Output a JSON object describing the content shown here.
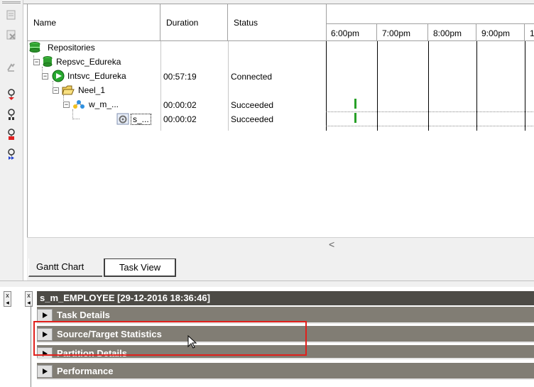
{
  "grid": {
    "headers": {
      "name": "Name",
      "duration": "Duration",
      "status": "Status"
    },
    "time_columns": [
      "6:00pm",
      "7:00pm",
      "8:00pm",
      "9:00pm",
      "1"
    ],
    "rows": [
      {
        "name": "Repositories",
        "duration": "",
        "status": ""
      },
      {
        "name": "Repsvc_Edureka",
        "duration": "",
        "status": ""
      },
      {
        "name": "Intsvc_Edureka",
        "duration": "00:57:19",
        "status": "Connected"
      },
      {
        "name": "Neel_1",
        "duration": "",
        "status": ""
      },
      {
        "name": "w_m_...",
        "duration": "00:00:02",
        "status": "Succeeded"
      },
      {
        "name": "s_...",
        "duration": "00:00:02",
        "status": "Succeeded"
      }
    ],
    "tree_glyphs": {
      "minus": "−"
    }
  },
  "scroll": {
    "left_arrow": "<"
  },
  "tabs": [
    {
      "label": "Gantt Chart",
      "active": false
    },
    {
      "label": "Task View",
      "active": true
    }
  ],
  "details": {
    "title": "s_m_EMPLOYEE [29-12-2016 18:36:46]",
    "sections": [
      {
        "label": "Task Details"
      },
      {
        "label": "Source/Target Statistics"
      },
      {
        "label": "Partition Details"
      },
      {
        "label": "Performance"
      }
    ],
    "mini_ctrl_glyphs": [
      "x",
      "◂"
    ]
  },
  "colors": {
    "title_bar": "#4d4b46",
    "section_bar": "#817d74",
    "highlight": "#e0201c",
    "gantt_bar": "#28a028"
  },
  "icons": {
    "toolbar": [
      "edit-task-icon",
      "delete-task-icon",
      "properties-icon",
      "start-workflow-icon",
      "stop-workflow-icon",
      "abort-workflow-icon",
      "resume-workflow-icon"
    ],
    "tree": [
      "repository-db-icon",
      "repository-db-icon",
      "integration-service-icon",
      "folder-icon",
      "workflow-icon",
      "session-icon"
    ]
  }
}
